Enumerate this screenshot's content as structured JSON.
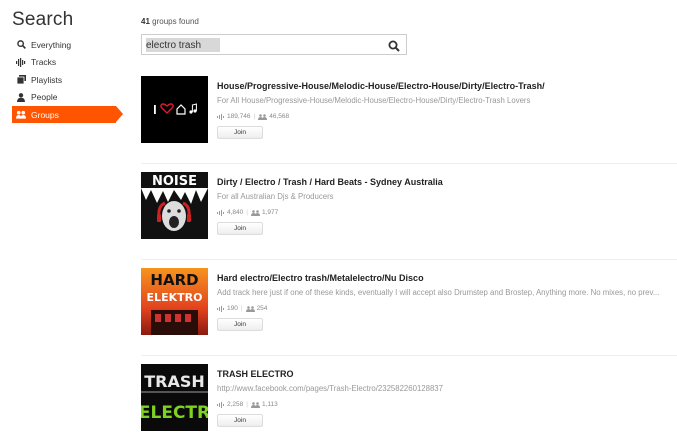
{
  "sidebar": {
    "heading": "Search",
    "items": [
      {
        "label": "Everything",
        "icon": "search-icon"
      },
      {
        "label": "Tracks",
        "icon": "waveform-icon"
      },
      {
        "label": "Playlists",
        "icon": "playlist-icon"
      },
      {
        "label": "People",
        "icon": "person-icon"
      },
      {
        "label": "Groups",
        "icon": "groups-icon",
        "active": true
      }
    ]
  },
  "results_header": {
    "count": "41",
    "suffix": "groups found"
  },
  "search": {
    "value": "electro trash"
  },
  "colors": {
    "accent": "#ff5500"
  },
  "groups": [
    {
      "title": "House/Progressive-House/Melodic-House/Electro-House/Dirty/Electro-Trash/",
      "description": "For All House/Progressive-House/Melodic-House/Electro-House/Dirty/Electro-Trash Lovers",
      "tracks": "189,746",
      "members": "46,568",
      "join_label": "Join"
    },
    {
      "title": "Dirty / Electro / Trash / Hard Beats - Sydney Australia",
      "description": "For all Australian Djs & Producers",
      "tracks": "4,840",
      "members": "1,977",
      "join_label": "Join",
      "art_text": "NOISE"
    },
    {
      "title": "Hard electro/Electro trash/Metalelectro/Nu Disco",
      "description": "Add track here just if one of these kinds, eventually I will accept also Drumstep and Brostep, Anything more. No mixes, no prev...",
      "tracks": "190",
      "members": "254",
      "join_label": "Join",
      "art_text_1": "HARD",
      "art_text_2": "ELEKTRO"
    },
    {
      "title": "TRASH ELECTRO",
      "description": "http://www.facebook.com/pages/Trash-Electro/232582260128837",
      "tracks": "2,258",
      "members": "1,113",
      "join_label": "Join",
      "art_text_1": "TRASH",
      "art_text_2": "ELECTR"
    }
  ]
}
